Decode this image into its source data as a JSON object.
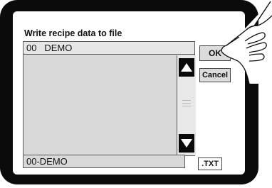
{
  "dialog": {
    "title": "Write recipe data to file"
  },
  "recipe_list": {
    "items": [
      {
        "number": "00",
        "name": "DEMO"
      }
    ]
  },
  "buttons": {
    "ok_label": "OK",
    "cancel_label": "Cancel"
  },
  "filename": {
    "value": "00-DEMO",
    "extension": ".TXT"
  },
  "icons": {
    "scroll_up": "up-arrow-icon",
    "scroll_down": "down-arrow-icon",
    "pointer": "hand-pointer-icon"
  }
}
